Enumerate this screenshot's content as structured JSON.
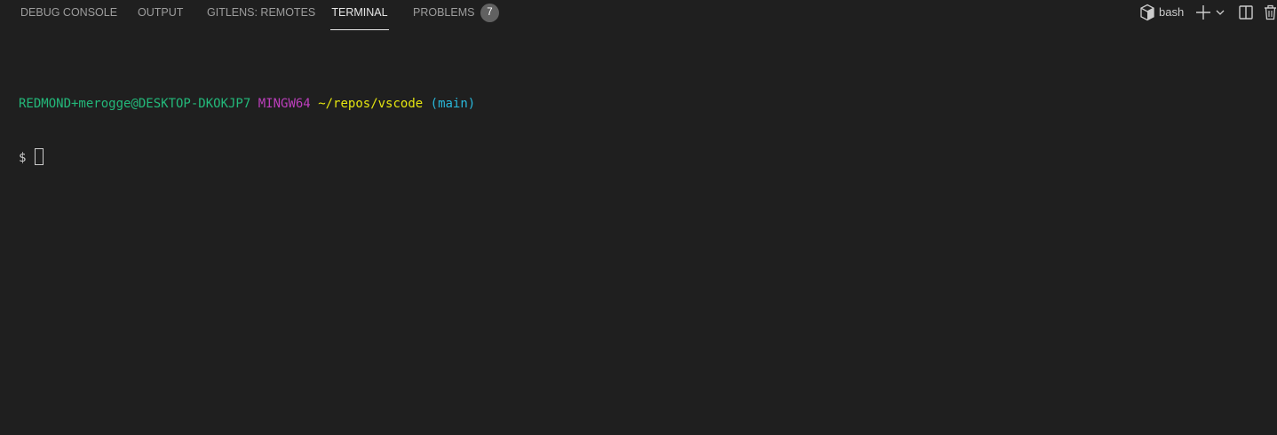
{
  "tabs": [
    {
      "label": "DEBUG CONSOLE"
    },
    {
      "label": "OUTPUT"
    },
    {
      "label": "GITLENS: REMOTES"
    },
    {
      "label": "TERMINAL",
      "active": true
    },
    {
      "label": "PROBLEMS"
    }
  ],
  "problems_count": "7",
  "actions": {
    "shell_label": "bash",
    "shell_icon": "box-icon",
    "add_icon": "plus-icon",
    "dropdown_icon": "chevron-down-icon",
    "split_icon": "split-terminal-icon",
    "kill_icon": "trash-icon"
  },
  "terminal": {
    "user_host": "REDMOND+merogge@DESKTOP-DKOKJP7",
    "system": "MINGW64",
    "path": "~/repos/vscode",
    "branch": "(main)",
    "prompt": "$"
  },
  "colors": {
    "background": "#1f1f1f",
    "user_host": "#23b87a",
    "system": "#bc3fbc",
    "path": "#e5e510",
    "branch": "#29b8db",
    "badge": "#616161"
  }
}
